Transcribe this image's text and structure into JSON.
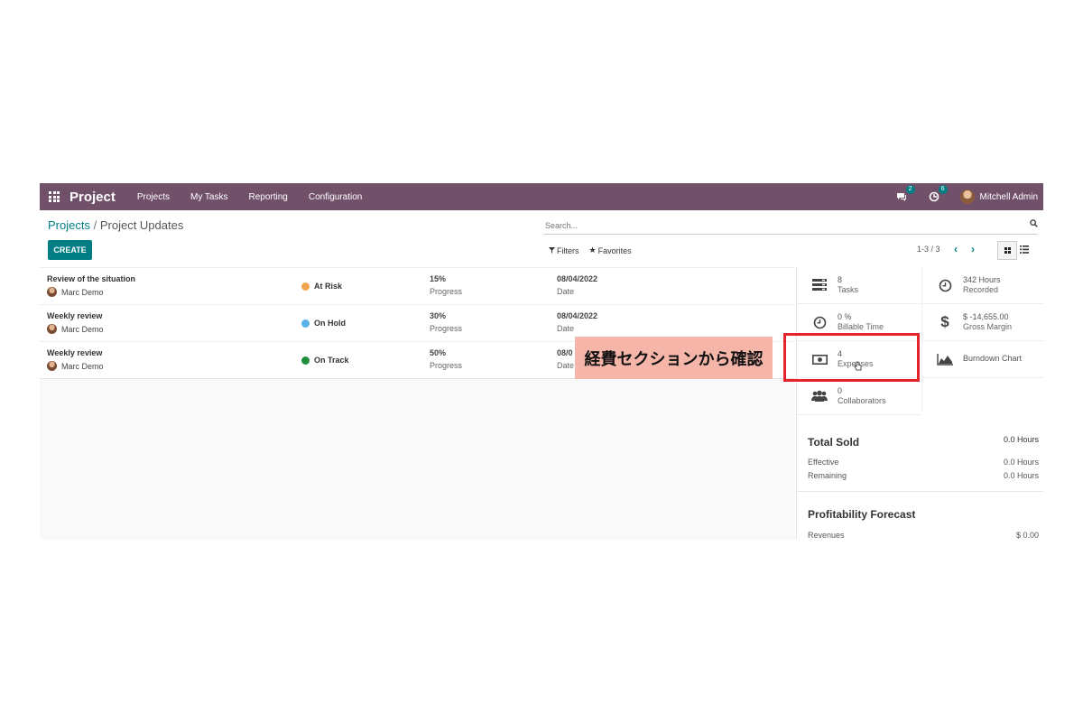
{
  "navbar": {
    "app_title": "Project",
    "menu": [
      "Projects",
      "My Tasks",
      "Reporting",
      "Configuration"
    ],
    "messages_badge": "2",
    "activities_badge": "6",
    "user_name": "Mitchell Admin",
    "bg_color": "#71516a"
  },
  "breadcrumb": {
    "parent": "Projects",
    "separator": "/",
    "current": "Project Updates"
  },
  "search": {
    "placeholder": "Search..."
  },
  "controls": {
    "create_label": "CREATE",
    "filters_label": "Filters",
    "favorites_label": "Favorites",
    "pager": "1-3 / 3",
    "accent_color": "#017e84"
  },
  "updates": [
    {
      "title": "Review of the situation",
      "author": "Marc Demo",
      "status": "At Risk",
      "status_color": "#f0a64c",
      "progress": "15%",
      "progress_label": "Progress",
      "date": "08/04/2022",
      "date_label": "Date"
    },
    {
      "title": "Weekly review",
      "author": "Marc Demo",
      "status": "On Hold",
      "status_color": "#5ab3e8",
      "progress": "30%",
      "progress_label": "Progress",
      "date": "08/04/2022",
      "date_label": "Date"
    },
    {
      "title": "Weekly review",
      "author": "Marc Demo",
      "status": "On Track",
      "status_color": "#1e8e3e",
      "progress": "50%",
      "progress_label": "Progress",
      "date": "08/0",
      "date_label": "Date"
    }
  ],
  "stats": {
    "tasks": {
      "value": "8",
      "label": "Tasks",
      "icon": "tasks-icon"
    },
    "hours": {
      "value": "342 Hours",
      "label": "Recorded",
      "icon": "clock-icon"
    },
    "billable": {
      "value": "0 %",
      "label": "Billable Time",
      "icon": "clock-icon"
    },
    "margin": {
      "value": "$ -14,655.00",
      "label": "Gross Margin",
      "icon": "dollar-icon"
    },
    "expenses": {
      "value": "4",
      "label": "Expenses",
      "icon": "money-icon"
    },
    "burndown": {
      "label": "Burndown Chart",
      "icon": "area-chart-icon"
    },
    "collaborators": {
      "value": "0",
      "label": "Collaborators",
      "icon": "users-icon"
    }
  },
  "total_sold": {
    "title": "Total Sold",
    "value": "0.0 Hours",
    "rows": [
      {
        "label": "Effective",
        "value": "0.0 Hours"
      },
      {
        "label": "Remaining",
        "value": "0.0 Hours"
      }
    ]
  },
  "profitability": {
    "title": "Profitability Forecast",
    "rows": [
      {
        "label": "Revenues",
        "value": "$ 0.00"
      }
    ]
  },
  "annotation": {
    "text": "経費セクションから確認",
    "highlight_color": "#e3242b",
    "callout_bg": "#f6b5a9"
  }
}
